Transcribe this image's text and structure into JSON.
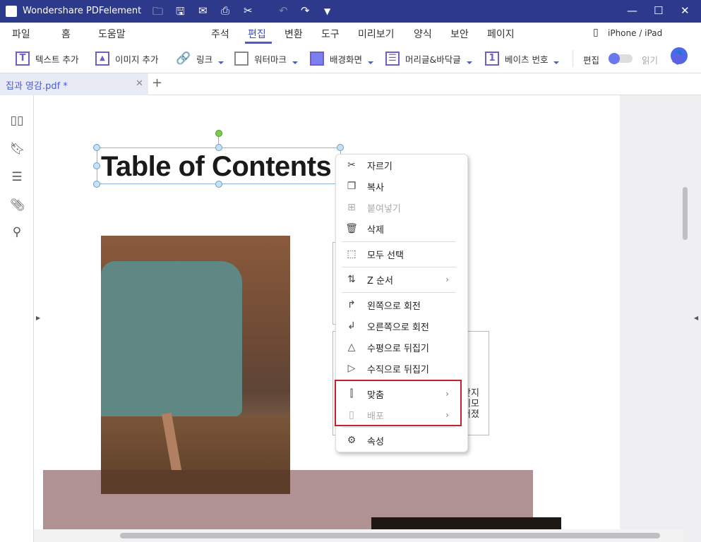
{
  "app": {
    "title": "Wondershare PDFelement"
  },
  "titlebar": {
    "icons": [
      "open-folder-icon",
      "save-icon",
      "mail-icon",
      "print-icon",
      "scissors-icon",
      "undo-icon",
      "redo-icon",
      "dropdown-icon"
    ],
    "minimize": "—",
    "maximize": "☐",
    "close": "✕"
  },
  "menu": {
    "items": [
      "파일",
      "홈",
      "도움말",
      "주석",
      "편집",
      "변환",
      "도구",
      "미리보기",
      "양식",
      "보안",
      "페이지"
    ],
    "active": "편집",
    "device": "iPhone / iPad"
  },
  "toolbar": {
    "add_text": "텍스트 추가",
    "add_image": "이미지 추가",
    "link": "링크",
    "watermark": "워터마크",
    "background": "배경화면",
    "header_footer": "머리글&바닥글",
    "bates": "베이츠 번호",
    "edit": "편집",
    "read": "읽기",
    "number_glyph": "1",
    "text_glyph": "T"
  },
  "tab": {
    "name": "집과 영감.pdf *",
    "close": "✕",
    "add": "+"
  },
  "page": {
    "title": "Table of Contents",
    "partial_lines": [
      "찾지",
      "이모",
      "어졌"
    ]
  },
  "context_menu": {
    "items": [
      {
        "label": "자르기",
        "icon": "scissors-icon",
        "glyph": "✂",
        "enabled": true
      },
      {
        "label": "복사",
        "icon": "copy-icon",
        "glyph": "❐",
        "enabled": true
      },
      {
        "label": "붙여넣기",
        "icon": "paste-icon",
        "glyph": "⊞",
        "enabled": false
      },
      {
        "label": "삭제",
        "icon": "trash-icon",
        "glyph": "🗑",
        "enabled": true
      },
      {
        "label": "모두 선택",
        "icon": "select-all-icon",
        "glyph": "⬚",
        "enabled": true
      },
      {
        "label": "Z 순서",
        "icon": "z-order-icon",
        "glyph": "⇅",
        "enabled": true,
        "submenu": true
      },
      {
        "label": "왼쪽으로 회전",
        "icon": "rotate-left-icon",
        "glyph": "↱",
        "enabled": true
      },
      {
        "label": "오른쪽으로 회전",
        "icon": "rotate-right-icon",
        "glyph": "↲",
        "enabled": true
      },
      {
        "label": "수평으로 뒤집기",
        "icon": "flip-horizontal-icon",
        "glyph": "△",
        "enabled": true
      },
      {
        "label": "수직으로 뒤집기",
        "icon": "flip-vertical-icon",
        "glyph": "▷",
        "enabled": true
      },
      {
        "label": "맞춤",
        "icon": "align-icon",
        "glyph": "⫿",
        "enabled": true,
        "submenu": true
      },
      {
        "label": "배포",
        "icon": "distribute-icon",
        "glyph": "▯",
        "enabled": false,
        "submenu": true
      },
      {
        "label": "속성",
        "icon": "gear-icon",
        "glyph": "⚙",
        "enabled": true
      }
    ],
    "submenu_arrow": "›"
  },
  "colors": {
    "titlebar": "#2d3a8c",
    "accent": "#4a5bd6",
    "highlight": "#c8202e"
  }
}
